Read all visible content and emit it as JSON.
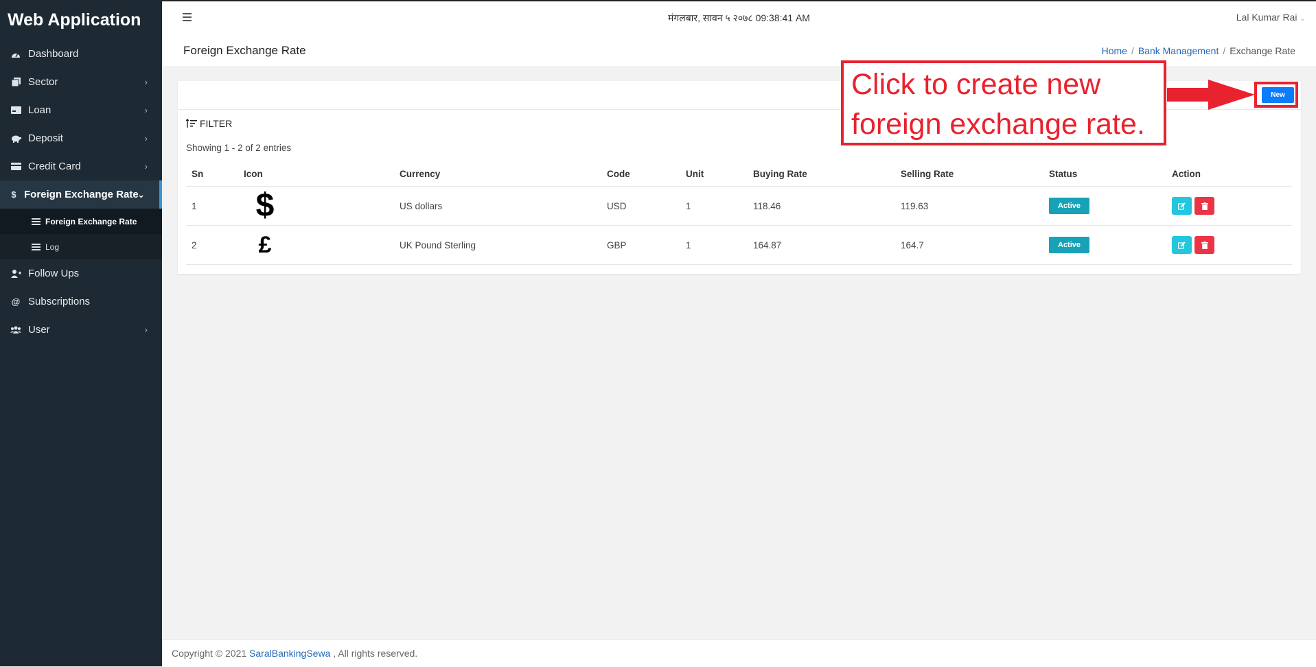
{
  "app": {
    "brand": "Web Application"
  },
  "sidebar": {
    "items": [
      {
        "label": "Dashboard",
        "icon": "dashboard-icon"
      },
      {
        "label": "Sector",
        "icon": "sector-icon"
      },
      {
        "label": "Loan",
        "icon": "loan-icon"
      },
      {
        "label": "Deposit",
        "icon": "piggy-bank-icon"
      },
      {
        "label": "Credit Card",
        "icon": "credit-card-icon"
      },
      {
        "label": "Foreign Exchange Rate",
        "icon": "dollar-icon"
      },
      {
        "label": "Follow Ups",
        "icon": "user-plus-icon"
      },
      {
        "label": "Subscriptions",
        "icon": "at-icon"
      },
      {
        "label": "User",
        "icon": "users-icon"
      }
    ],
    "sub_items": [
      {
        "label": "Foreign Exchange Rate"
      },
      {
        "label": "Log"
      }
    ]
  },
  "topbar": {
    "datetime": "मंगलबार, सावन ५ २०७८ 09:38:41 AM",
    "user": "Lal Kumar Rai"
  },
  "page": {
    "title": "Foreign Exchange Rate",
    "breadcrumb": [
      "Home",
      "Bank Management",
      "Exchange Rate"
    ]
  },
  "card": {
    "new_label": "New",
    "filter_label": "FILTER",
    "showing": "Showing 1 - 2 of 2 entries"
  },
  "table": {
    "columns": [
      "Sn",
      "Icon",
      "Currency",
      "Code",
      "Unit",
      "Buying Rate",
      "Selling Rate",
      "Status",
      "Action"
    ],
    "rows": [
      {
        "sn": "1",
        "icon": "$",
        "currency": "US dollars",
        "code": "USD",
        "unit": "1",
        "buying": "118.46",
        "selling": "119.63",
        "status": "Active"
      },
      {
        "sn": "2",
        "icon": "£",
        "currency": "UK Pound Sterling",
        "code": "GBP",
        "unit": "1",
        "buying": "164.87",
        "selling": "164.7",
        "status": "Active"
      }
    ]
  },
  "annotation": {
    "line1": "Click to create new",
    "line2": "foreign exchange rate."
  },
  "footer": {
    "prefix": "Copyright © 2021 ",
    "link": "SaralBankingSewa",
    "suffix": " , All rights reserved."
  },
  "colors": {
    "sidebar_bg": "#1e2a33",
    "primary": "#0b7cfb",
    "status_active": "#17a2b8",
    "edit": "#22c7dd",
    "delete": "#eb3446",
    "annotation": "#e8222f"
  }
}
